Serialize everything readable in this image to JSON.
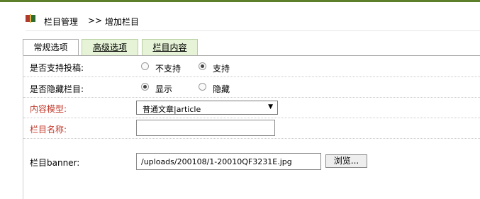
{
  "breadcrumb": {
    "item1": "栏目管理",
    "separator": ">>",
    "item2": "增加栏目"
  },
  "tabs": [
    {
      "label": "常规选项",
      "active": true
    },
    {
      "label": "高级选项",
      "active": false
    },
    {
      "label": "栏目内容",
      "active": false
    }
  ],
  "form": {
    "allow_submit": {
      "label": "是否支持投稿:",
      "options": [
        {
          "label": "不支持",
          "checked": false
        },
        {
          "label": "支持",
          "checked": true
        }
      ]
    },
    "hide_column": {
      "label": "是否隐藏栏目:",
      "options": [
        {
          "label": "显示",
          "checked": true
        },
        {
          "label": "隐藏",
          "checked": false
        }
      ]
    },
    "content_model": {
      "label": "内容模型:",
      "value": "普通文章|article"
    },
    "column_name": {
      "label": "栏目名称:",
      "value": ""
    },
    "banner": {
      "label": "栏目banner:",
      "value": "/uploads/200108/1-20010QF3231E.jpg",
      "browse_label": "浏览..."
    }
  },
  "colors": {
    "required_label": "#c0392b",
    "tab_inactive_bg": "#e6f3d6",
    "top_bar": "#5c7f2c"
  }
}
